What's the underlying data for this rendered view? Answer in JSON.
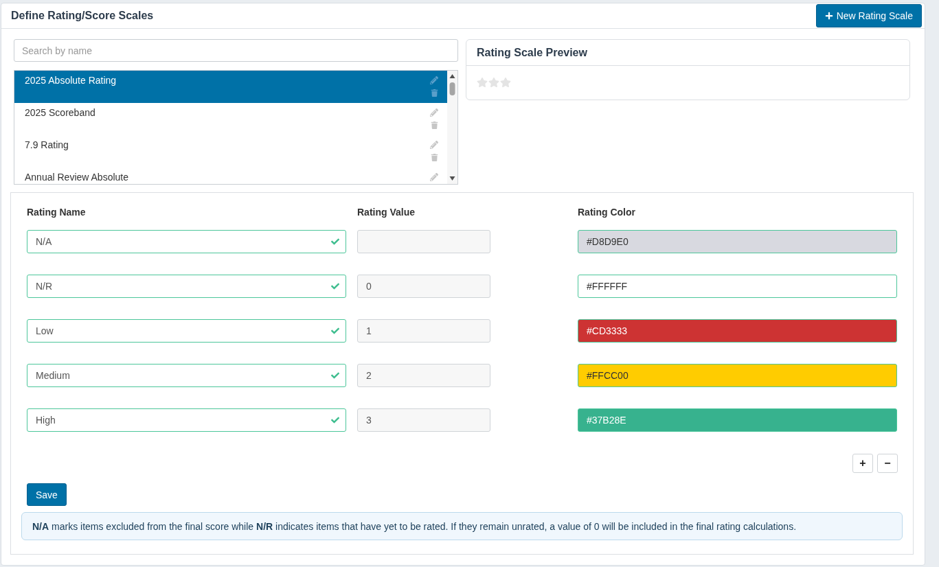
{
  "header": {
    "title": "Define Rating/Score Scales",
    "new_button": "New Rating Scale"
  },
  "search": {
    "placeholder": "Search by name"
  },
  "scales": [
    {
      "name": "2025 Absolute Rating",
      "selected": true
    },
    {
      "name": "2025 Scoreband",
      "selected": false
    },
    {
      "name": "7.9 Rating",
      "selected": false
    },
    {
      "name": "Annual Review Absolute",
      "selected": false
    }
  ],
  "preview": {
    "title": "Rating Scale Preview",
    "stars": 0
  },
  "ratings_table": {
    "columns": [
      "Rating Name",
      "Rating Value",
      "Rating Color"
    ],
    "rows": [
      {
        "name": "N/A",
        "valid": true,
        "color": "#D8D9E0"
      },
      {
        "name": "N/R",
        "valid": true,
        "value": "0",
        "color": "#FFFFFF"
      },
      {
        "name": "Low",
        "valid": true,
        "value": "1",
        "color": "#CD3333"
      },
      {
        "name": "Medium",
        "valid": true,
        "value": "2",
        "color": "#FFCC00"
      },
      {
        "name": "High",
        "valid": true,
        "value": "3",
        "color": "#37B28E"
      }
    ]
  },
  "row_buttons": [
    "+",
    "−"
  ],
  "save_button": "Save",
  "note": "**N/A** marks items excluded from the final score while **N/R** indicates items that have yet to be rated. If they remain unrated, a value of 0 will be included in the final rating calculations."
}
